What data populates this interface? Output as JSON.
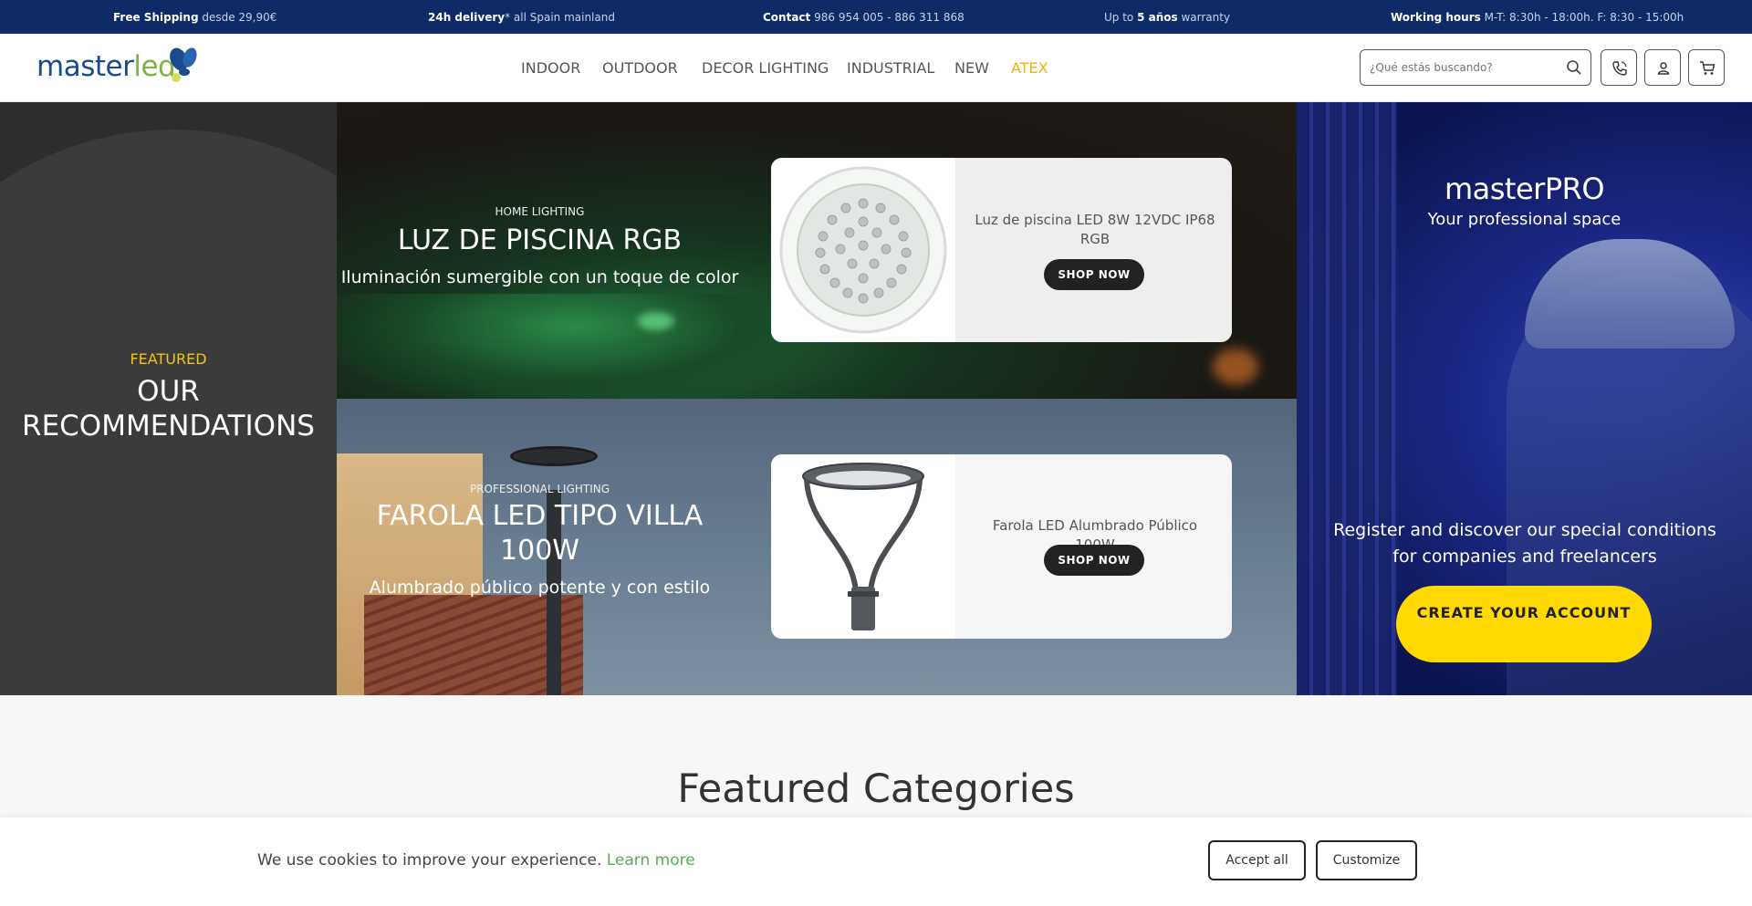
{
  "topbar": {
    "shipping_bold": "Free Shipping",
    "shipping_rest": " desde 29,90€",
    "delivery_bold": "24h delivery",
    "delivery_rest": "* all Spain mainland",
    "contact_bold": "Contact",
    "contact_rest": " 986 954 005 - 886 311 868",
    "warranty_pre": "Up to ",
    "warranty_bold": "5 años",
    "warranty_post": " warranty",
    "hours_bold": "Working hours",
    "hours_rest": " M-T: 8:30h - 18:00h. F: 8:30 - 15:00h"
  },
  "header": {
    "logo_main": "master",
    "logo_accent": "led",
    "nav": [
      "INDOOR",
      "OUTDOOR",
      "DECOR LIGHTING",
      "INDUSTRIAL",
      "NEW",
      "ATEX"
    ],
    "search_placeholder": "¿Qué estás buscando?"
  },
  "featured": {
    "label": "FEATURED",
    "title_line1": "OUR",
    "title_line2": "RECOMMENDATIONS"
  },
  "promos": [
    {
      "tag": "HOME LIGHTING",
      "title": "LUZ DE PISCINA RGB",
      "subtitle": "Iluminación sumergible con un toque de color",
      "product_name": "Luz de piscina LED 8W 12VDC IP68 RGB",
      "button": "SHOP NOW"
    },
    {
      "tag": "PROFESSIONAL LIGHTING",
      "title": "FAROLA LED TIPO VILLA 100W",
      "subtitle": "Alumbrado público potente y con estilo",
      "product_name": "Farola LED Alumbrado Público 100W",
      "button": "SHOP NOW"
    }
  ],
  "masterpro": {
    "brand_main": "master",
    "brand_accent": "PRO",
    "tagline": "Your professional space",
    "register_text": "Register and discover our special conditions for companies and freelancers",
    "cta": "CREATE YOUR ACCOUNT"
  },
  "categories": {
    "title": "Featured Categories"
  },
  "cookie": {
    "message": "We use cookies to improve your experience. ",
    "learn_more": "Learn more",
    "accept": "Accept all",
    "customize": "Customize"
  },
  "colors": {
    "topbar": "#0c2b67",
    "accent_yellow": "#ffd900",
    "atex": "#f0b400",
    "link_green": "#5bab5b"
  }
}
